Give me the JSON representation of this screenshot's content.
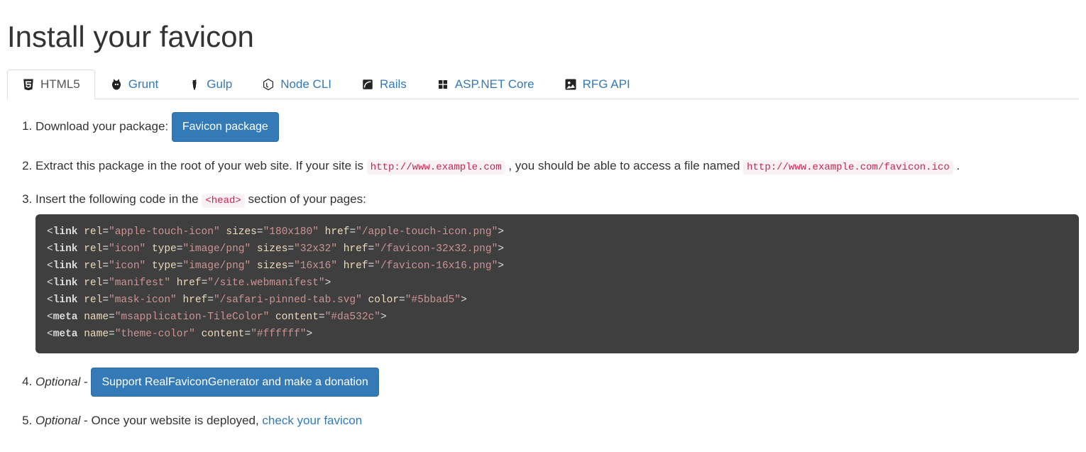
{
  "heading": "Install your favicon",
  "tabs": [
    {
      "label": "HTML5",
      "active": true
    },
    {
      "label": "Grunt",
      "active": false
    },
    {
      "label": "Gulp",
      "active": false
    },
    {
      "label": "Node CLI",
      "active": false
    },
    {
      "label": "Rails",
      "active": false
    },
    {
      "label": "ASP.NET Core",
      "active": false
    },
    {
      "label": "RFG API",
      "active": false
    }
  ],
  "steps": {
    "s1_prefix": "Download your package: ",
    "s1_button": "Favicon package",
    "s2_prefix": "Extract this package in the root of your web site. If your site is ",
    "s2_code1": "http://www.example.com",
    "s2_mid": ", you should be able to access a file named ",
    "s2_code2": "http://www.example.com/favicon.ico",
    "s2_suffix": ".",
    "s3_prefix": "Insert the following code in the ",
    "s3_code": "<head>",
    "s3_suffix": " section of your pages:",
    "s3_lines": [
      {
        "tag": "link",
        "attrs": [
          {
            "name": "rel",
            "value": "apple-touch-icon"
          },
          {
            "name": "sizes",
            "value": "180x180"
          },
          {
            "name": "href",
            "value": "/apple-touch-icon.png"
          }
        ]
      },
      {
        "tag": "link",
        "attrs": [
          {
            "name": "rel",
            "value": "icon"
          },
          {
            "name": "type",
            "value": "image/png"
          },
          {
            "name": "sizes",
            "value": "32x32"
          },
          {
            "name": "href",
            "value": "/favicon-32x32.png"
          }
        ]
      },
      {
        "tag": "link",
        "attrs": [
          {
            "name": "rel",
            "value": "icon"
          },
          {
            "name": "type",
            "value": "image/png"
          },
          {
            "name": "sizes",
            "value": "16x16"
          },
          {
            "name": "href",
            "value": "/favicon-16x16.png"
          }
        ]
      },
      {
        "tag": "link",
        "attrs": [
          {
            "name": "rel",
            "value": "manifest"
          },
          {
            "name": "href",
            "value": "/site.webmanifest"
          }
        ]
      },
      {
        "tag": "link",
        "attrs": [
          {
            "name": "rel",
            "value": "mask-icon"
          },
          {
            "name": "href",
            "value": "/safari-pinned-tab.svg"
          },
          {
            "name": "color",
            "value": "#5bbad5"
          }
        ]
      },
      {
        "tag": "meta",
        "attrs": [
          {
            "name": "name",
            "value": "msapplication-TileColor"
          },
          {
            "name": "content",
            "value": "#da532c"
          }
        ]
      },
      {
        "tag": "meta",
        "attrs": [
          {
            "name": "name",
            "value": "theme-color"
          },
          {
            "name": "content",
            "value": "#ffffff"
          }
        ]
      }
    ],
    "s4_optional": "Optional",
    "s4_dash": " - ",
    "s4_button": "Support RealFaviconGenerator and make a donation",
    "s5_optional": "Optional",
    "s5_dash": " - ",
    "s5_text": "Once your website is deployed, ",
    "s5_link": "check your favicon"
  }
}
